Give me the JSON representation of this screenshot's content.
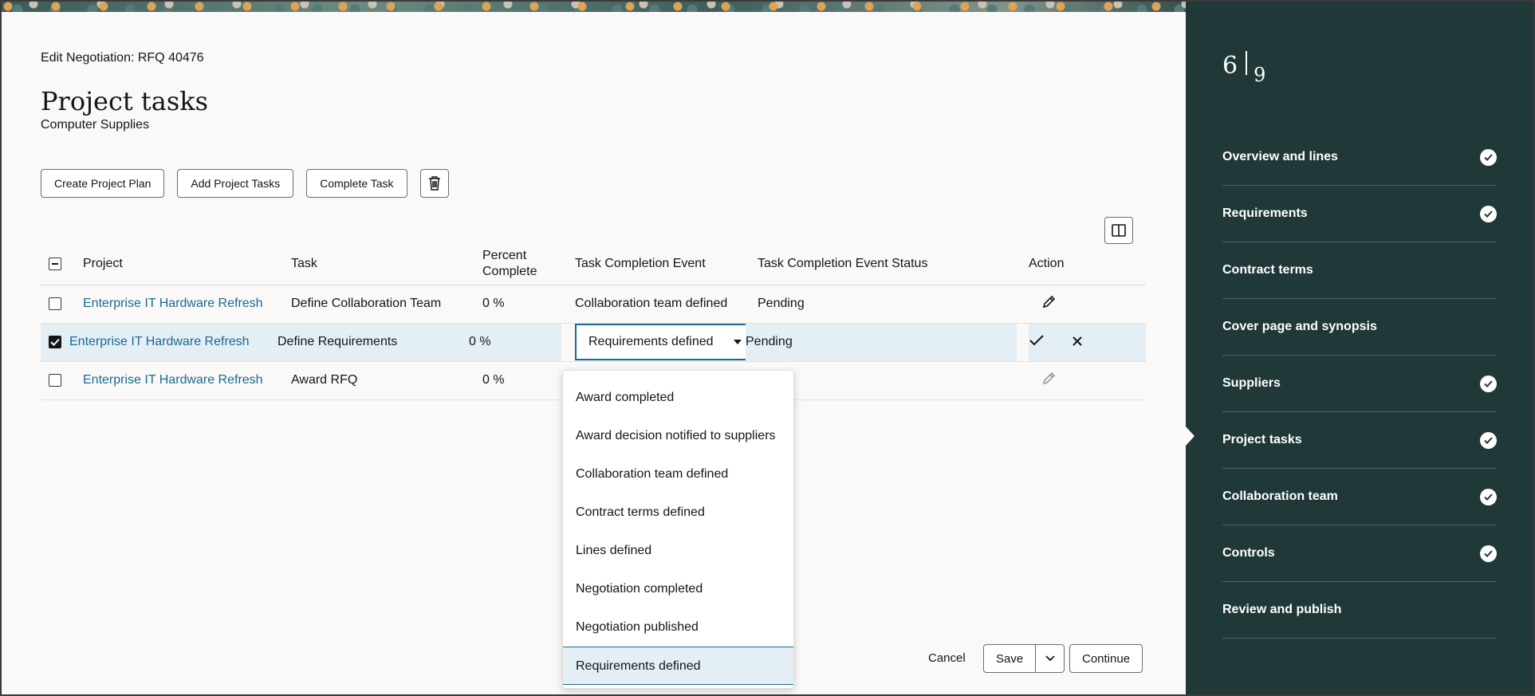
{
  "header": {
    "breadcrumb": "Edit Negotiation: RFQ 40476",
    "title": "Project tasks",
    "subtitle": "Computer Supplies"
  },
  "toolbar": {
    "create_plan": "Create Project Plan",
    "add_tasks": "Add Project Tasks",
    "complete_task": "Complete Task",
    "delete_icon": "trash-icon"
  },
  "table": {
    "columns": {
      "project": "Project",
      "task": "Task",
      "percent": "Percent Complete",
      "event": "Task Completion Event",
      "status": "Task Completion Event Status",
      "action": "Action"
    },
    "rows": [
      {
        "project": "Enterprise IT Hardware Refresh",
        "task": "Define Collaboration Team",
        "percent": "0 %",
        "event": "Collaboration team defined",
        "status": "Pending",
        "checked": false
      },
      {
        "project": "Enterprise IT Hardware Refresh",
        "task": "Define Requirements",
        "percent": "0 %",
        "event": "Requirements defined",
        "status": "Pending",
        "checked": true
      },
      {
        "project": "Enterprise IT Hardware Refresh",
        "task": "Award RFQ",
        "percent": "0 %",
        "event": "",
        "status": "",
        "checked": false
      }
    ]
  },
  "dropdown": {
    "options": [
      "Award completed",
      "Award decision notified to suppliers",
      "Collaboration team defined",
      "Contract terms defined",
      "Lines defined",
      "Negotiation completed",
      "Negotiation published",
      "Requirements defined"
    ],
    "selected": "Requirements defined"
  },
  "footer": {
    "cancel": "Cancel",
    "save": "Save",
    "continue": "Continue"
  },
  "train": {
    "current": "6",
    "total": "9",
    "steps": [
      {
        "label": "Overview and lines",
        "done": true
      },
      {
        "label": "Requirements",
        "done": true
      },
      {
        "label": "Contract terms",
        "done": false
      },
      {
        "label": "Cover page and synopsis",
        "done": false
      },
      {
        "label": "Suppliers",
        "done": true
      },
      {
        "label": "Project tasks",
        "done": true
      },
      {
        "label": "Collaboration team",
        "done": true
      },
      {
        "label": "Controls",
        "done": true
      },
      {
        "label": "Review and publish",
        "done": false
      }
    ]
  },
  "colors": {
    "link": "#1a6b91",
    "sidebar": "#213839",
    "selected_row": "#e4eef5"
  }
}
